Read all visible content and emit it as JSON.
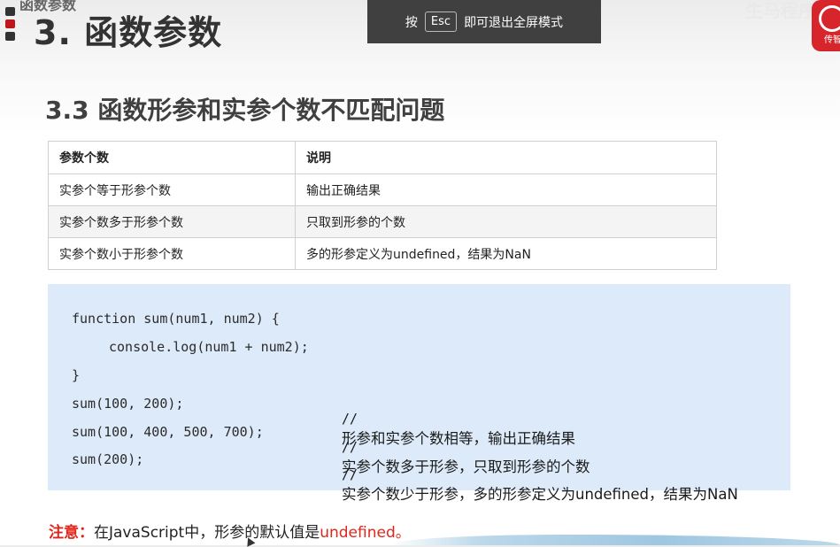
{
  "header": {
    "top_cut_text": "函数参数",
    "slide_title": "3. 函数参数"
  },
  "fullscreen_notice": {
    "before": "按",
    "key": "Esc",
    "after": "即可退出全屏模式"
  },
  "brand": {
    "faded_text": "生马程序",
    "logo_text": "传智"
  },
  "section": {
    "title": "3.3 函数形参和实参个数不匹配问题"
  },
  "table": {
    "headers": [
      "参数个数",
      "说明"
    ],
    "rows": [
      [
        "实参个等于形参个数",
        "输出正确结果"
      ],
      [
        "实参个数多于形参个数",
        "只取到形参的个数"
      ],
      [
        "实参个数小于形参个数",
        "多的形参定义为undefined，结果为NaN"
      ]
    ]
  },
  "code": {
    "lines": [
      "function sum(num1, num2) {",
      "console.log(num1 + num2);",
      "}",
      "sum(100, 200);",
      "sum(100, 400, 500, 700);",
      "sum(200);"
    ],
    "comments": [
      "形参和实参个数相等，输出正确结果",
      "实参个数多于形参，只取到形参的个数",
      "实参个数少于形参，多的形参定义为undefined，结果为NaN"
    ],
    "comment_marker": "//"
  },
  "note": {
    "label": "注意：",
    "text": "在JavaScript中，形参的默认值是",
    "highlight": "undefined。"
  },
  "colors": {
    "accent_red": "#e0261b",
    "code_bg": "#ddeaf9",
    "title_text": "#333333"
  }
}
